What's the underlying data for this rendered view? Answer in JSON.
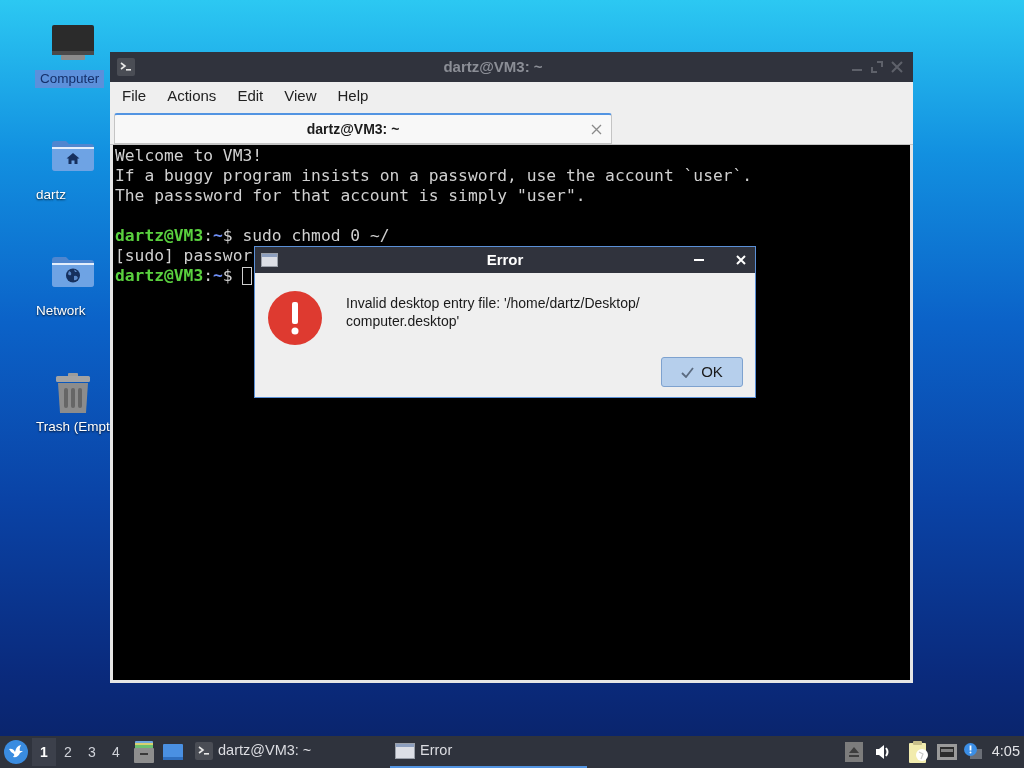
{
  "desktop_icons": [
    {
      "label": "Computer",
      "kind": "computer",
      "selected": true
    },
    {
      "label": "dartz",
      "kind": "home",
      "selected": false
    },
    {
      "label": "Network",
      "kind": "network",
      "selected": false
    },
    {
      "label": "Trash (Empt",
      "kind": "trash",
      "selected": false
    }
  ],
  "terminal_window": {
    "title": "dartz@VM3: ~",
    "active": false,
    "menu": [
      "File",
      "Actions",
      "Edit",
      "View",
      "Help"
    ],
    "tabs": [
      {
        "label": "dartz@VM3: ~",
        "selected": true
      }
    ],
    "lines": [
      {
        "kind": "output",
        "text": "Welcome to VM3!"
      },
      {
        "kind": "output",
        "text": "If a buggy program insists on a password, use the account `user`."
      },
      {
        "kind": "output",
        "text": "The passsword for that account is simply \"user\"."
      },
      {
        "kind": "blank"
      },
      {
        "kind": "prompt",
        "user_host": "dartz@VM3",
        "separator": ":",
        "path": "~",
        "symbol": "$",
        "command": "sudo chmod 0 ~/"
      },
      {
        "kind": "output",
        "text": "[sudo] passwor"
      },
      {
        "kind": "prompt",
        "user_host": "dartz@VM3",
        "separator": ":",
        "path": "~",
        "symbol": "$",
        "cursor": true
      }
    ]
  },
  "error_dialog": {
    "title": "Error",
    "message_lines": [
      "Invalid desktop entry file: '/home/dartz/Desktop/",
      "computer.desktop'"
    ],
    "buttons": [
      {
        "label": "OK"
      }
    ]
  },
  "taskbar": {
    "workspaces": [
      {
        "label": "1",
        "selected": true
      },
      {
        "label": "2",
        "selected": false
      },
      {
        "label": "3",
        "selected": false
      },
      {
        "label": "4",
        "selected": false
      }
    ],
    "tasks": [
      {
        "label": "dartz@VM3: ~",
        "kind": "terminal",
        "selected": false
      },
      {
        "label": "Error",
        "kind": "window",
        "selected": true
      }
    ],
    "clock": "4:05"
  }
}
